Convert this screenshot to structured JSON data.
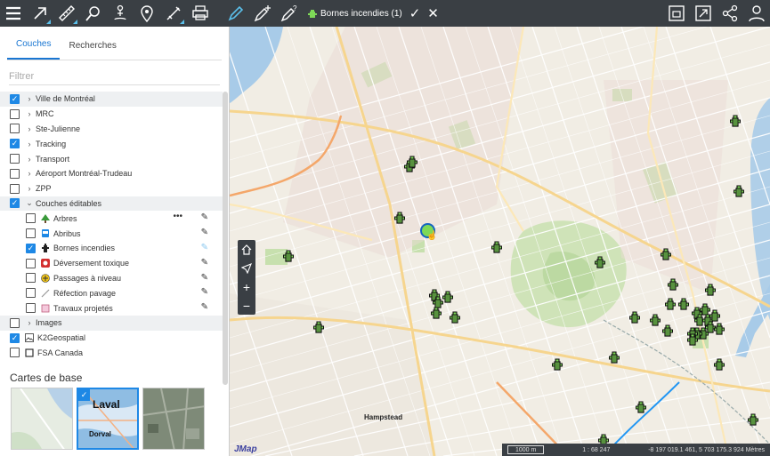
{
  "toolbar": {
    "icons": [
      "menu-icon",
      "arrow-icon",
      "ruler-icon",
      "location-search-icon",
      "person-pin-icon",
      "map-pin-icon",
      "route-icon",
      "printer-icon",
      "pencil-icon",
      "pencil-plus-icon",
      "pencil-question-icon"
    ],
    "title": "Bornes incendies (1)",
    "confirm": "✓",
    "cancel": "✕",
    "right_icons": [
      "frame-icon",
      "fullscreen-icon",
      "share-icon",
      "user-icon"
    ]
  },
  "sidebar": {
    "tabs": [
      {
        "label": "Couches",
        "active": true
      },
      {
        "label": "Recherches",
        "active": false
      }
    ],
    "filter_placeholder": "Filtrer",
    "layers": [
      {
        "label": "Ville de Montréal",
        "checked": true,
        "chevron": "›",
        "shaded": true
      },
      {
        "label": "MRC",
        "checked": false,
        "chevron": "›",
        "shaded": false
      },
      {
        "label": "Ste-Julienne",
        "checked": false,
        "chevron": "›",
        "shaded": false
      },
      {
        "label": "Tracking",
        "checked": true,
        "chevron": "›",
        "shaded": false
      },
      {
        "label": "Transport",
        "checked": false,
        "chevron": "›",
        "shaded": false
      },
      {
        "label": "Aéroport Montréal-Trudeau",
        "checked": false,
        "chevron": "›",
        "shaded": false
      },
      {
        "label": "ZPP",
        "checked": false,
        "chevron": "›",
        "shaded": false
      },
      {
        "label": "Couches éditables",
        "checked": true,
        "chevron": "⌄",
        "shaded": true
      }
    ],
    "sublayers": [
      {
        "label": "Arbres",
        "checked": false,
        "icon": "tree-icon",
        "color": "#3a9a3a"
      },
      {
        "label": "Abribus",
        "checked": false,
        "icon": "bus-icon",
        "color": "#1e88e5"
      },
      {
        "label": "Bornes incendies",
        "checked": true,
        "icon": "hydrant-icon",
        "color": "#222222"
      },
      {
        "label": "Déversement toxique",
        "checked": false,
        "icon": "toxic-icon",
        "color": "#d32f2f"
      },
      {
        "label": "Passages à niveau",
        "checked": false,
        "icon": "rail-crossing-icon",
        "color": "#d4a017"
      },
      {
        "label": "Réfection pavage",
        "checked": false,
        "icon": "line-icon",
        "color": "#999999"
      },
      {
        "label": "Travaux projetés",
        "checked": false,
        "icon": "polygon-icon",
        "color": "#d28fb0"
      }
    ],
    "more_layers": [
      {
        "label": "Images",
        "checked": false,
        "chevron": "›"
      },
      {
        "label": "K2Geospatial",
        "checked": true,
        "icon": "image-icon"
      },
      {
        "label": "FSA Canada",
        "checked": false,
        "icon": "square-icon"
      }
    ],
    "base_maps_title": "Cartes de base",
    "base_maps": [
      {
        "label": "",
        "selected": false
      },
      {
        "label": "Laval",
        "sublabel": "Dorval",
        "selected": true
      },
      {
        "label": "",
        "selected": false
      }
    ]
  },
  "map": {
    "place_label": "Hampstead",
    "brand": "JMap",
    "scale": "1000 m",
    "ratio": "1 : 68 247",
    "coords": "-8 197 019.1 461, 5 703 175.3 924 Mètres"
  },
  "colors": {
    "toolbar": "#3a3f44",
    "accent": "#1e88e5",
    "hydrant": "#7ed957"
  }
}
